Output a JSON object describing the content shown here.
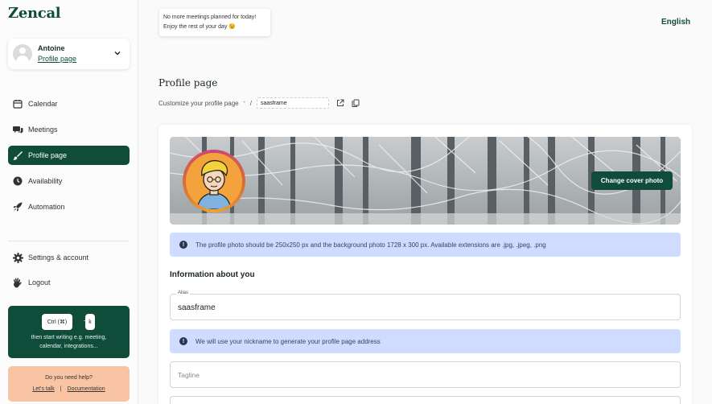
{
  "app": {
    "logo": "Zencal"
  },
  "user": {
    "name": "Antoine",
    "link": "Profile page"
  },
  "nav": {
    "items": [
      {
        "label": "Calendar",
        "icon": "calendar-icon"
      },
      {
        "label": "Meetings",
        "icon": "chat-bubbles-icon"
      },
      {
        "label": "Profile page",
        "icon": "paintbrush-icon",
        "active": true
      },
      {
        "label": "Availability",
        "icon": "clock-icon"
      },
      {
        "label": "Automation",
        "icon": "rocket-icon"
      }
    ],
    "bottom": [
      {
        "label": "Settings & account",
        "icon": "gear-icon"
      },
      {
        "label": "Logout",
        "icon": "waving-hand-icon"
      }
    ]
  },
  "shortcut": {
    "key1": "Ctrl (⌘)",
    "plus": "+",
    "key2": "k",
    "text_line1": "then start writing e.g. meeting,",
    "text_line2": "calendar, integrations..."
  },
  "help": {
    "title": "Do you need help?",
    "link1": "Let's talk",
    "separator": "|",
    "link2": "Documentation"
  },
  "notice": {
    "line1": "No more meetings planned for today!",
    "line2": "Enjoy the rest of your day 😉"
  },
  "language": "English",
  "page": {
    "title": "Profile page",
    "breadcrumb": "Customize your profile page",
    "breadcrumb_dot": "•",
    "slash": "/",
    "slug": "saasframe"
  },
  "cover": {
    "change_button": "Change cover photo"
  },
  "info_photo": "The profile photo should be 250x250 px and the background photo 1728 x 300 px. Available extensions are .jpg, .jpeg, .png",
  "section": {
    "title": "Information about you"
  },
  "alias": {
    "label": "Alias",
    "value": "saasframe"
  },
  "info_alias": "We will use your nickname to generate your profile page address",
  "tagline": {
    "placeholder": "Tagline"
  },
  "colors": {
    "brand": "#0f4c3a",
    "info_bg": "#cfdcff",
    "help_bg": "#f8c4a4"
  }
}
